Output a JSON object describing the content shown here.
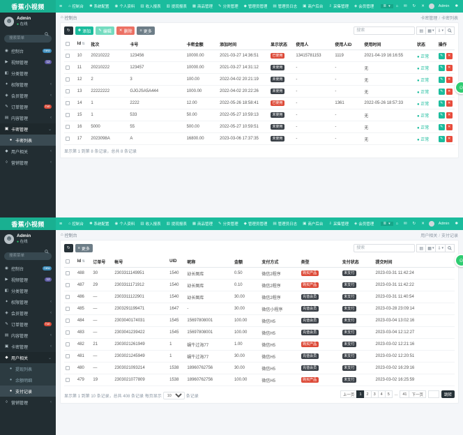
{
  "brand": {
    "logo": "香蕉小视频"
  },
  "colors": {
    "red": "#dd4b39",
    "dark": "#3b4148",
    "blue": "#3c8dbc",
    "purple": "#605ca8",
    "green": "#1bbc9d"
  },
  "topnav": {
    "burger": "≡",
    "dropdown_glyph": "≣",
    "user": "Admin",
    "settings_glyph": "✱",
    "items": [
      {
        "key": "dashboard",
        "label": "控制台",
        "glyph": "⌂"
      },
      {
        "key": "system-config",
        "label": "系统配置",
        "glyph": "✱"
      },
      {
        "key": "profile",
        "label": "个人资料",
        "glyph": "◉"
      },
      {
        "key": "income-report",
        "label": "收入报表",
        "glyph": "▥"
      },
      {
        "key": "withdraw-report",
        "label": "提现报表",
        "glyph": "▥"
      },
      {
        "key": "goods",
        "label": "商品管理",
        "glyph": "▦"
      },
      {
        "key": "category",
        "label": "分类管理",
        "glyph": "✎"
      },
      {
        "key": "admin-manage",
        "label": "管理员管理",
        "glyph": "◆"
      },
      {
        "key": "admin-log",
        "label": "管理员日志",
        "glyph": "▤"
      },
      {
        "key": "merchant",
        "label": "商户后台",
        "glyph": "▣"
      },
      {
        "key": "collect",
        "label": "采集管理",
        "glyph": "⇩"
      },
      {
        "key": "member",
        "label": "会员管理",
        "glyph": "◈"
      }
    ],
    "right_icons": [
      {
        "key": "home",
        "glyph": "⌂"
      },
      {
        "key": "message",
        "glyph": "✉"
      },
      {
        "key": "refresh",
        "glyph": "↻"
      },
      {
        "key": "close",
        "glyph": "✕"
      }
    ]
  },
  "sidebar": {
    "user": {
      "name": "Admin",
      "status": "在线"
    },
    "search_placeholder": "搜索菜单"
  },
  "panels": [
    {
      "breadcrumb": {
        "home": "控制台",
        "parent": "卡密管理",
        "current": "卡密列表"
      },
      "search_placeholder": "搜索",
      "records_text": "显示第 1 到第 8 条记录，总共 8 条记录",
      "toolbar": [
        {
          "key": "refresh",
          "icon": "↻",
          "cls": "dark"
        },
        {
          "key": "add",
          "icon": "✚",
          "label": "添加",
          "cls": "green"
        },
        {
          "key": "edit",
          "icon": "✎",
          "label": "编辑",
          "cls": "teal"
        },
        {
          "key": "delete",
          "icon": "✕",
          "label": "删除",
          "cls": "red"
        },
        {
          "key": "more",
          "icon": "≡",
          "label": "更多",
          "cls": "grey"
        }
      ],
      "sidebar": [
        {
          "key": "dashboard",
          "label": "控制台",
          "glyph": "◉",
          "icon": "dashboard-icon",
          "badge": {
            "t": "new",
            "c": "blue"
          }
        },
        {
          "key": "video",
          "label": "视频管理",
          "glyph": "▶",
          "icon": "video-icon",
          "badge": {
            "t": "12",
            "c": "purple"
          }
        },
        {
          "key": "category",
          "label": "分类管理",
          "glyph": "◧",
          "icon": "category-icon"
        },
        {
          "key": "permission",
          "label": "权限管理",
          "glyph": "✦",
          "icon": "permission-icon",
          "chevron": "‹"
        },
        {
          "key": "member",
          "label": "会员管理",
          "glyph": "◈",
          "icon": "member-icon",
          "chevron": "‹"
        },
        {
          "key": "order",
          "label": "订单管理",
          "glyph": "✎",
          "icon": "order-icon",
          "badge": {
            "t": "hot",
            "c": "red"
          }
        },
        {
          "key": "content",
          "label": "内容管理",
          "glyph": "▤",
          "icon": "content-icon",
          "chevron": "‹"
        },
        {
          "key": "card",
          "label": "卡密管理",
          "glyph": "▣",
          "icon": "card-icon",
          "chevron": "⌄",
          "open": true
        },
        {
          "key": "card-list",
          "label": "卡密列表",
          "glyph": "●",
          "icon": "dot-icon",
          "sub": true,
          "active": true
        },
        {
          "key": "user",
          "label": "用户相关",
          "glyph": "◆",
          "icon": "user-icon",
          "chevron": "‹"
        },
        {
          "key": "marketing",
          "label": "营销管理",
          "glyph": "◊",
          "icon": "marketing-icon",
          "chevron": "‹"
        }
      ],
      "table": {
        "columns": [
          {
            "key": "check",
            "type": "check",
            "label": "",
            "w": "3%"
          },
          {
            "key": "id",
            "label": "Id",
            "sort": true,
            "w": "3.5%"
          },
          {
            "key": "batch",
            "label": "批次",
            "w": "10%"
          },
          {
            "key": "card-no",
            "label": "卡号",
            "w": "14.5%"
          },
          {
            "key": "amount",
            "label": "卡密金额",
            "w": "8.5%"
          },
          {
            "key": "add-time",
            "label": "添加时间",
            "w": "13%"
          },
          {
            "key": "show-status",
            "type": "badge",
            "label": "显示状态",
            "w": "6.5%"
          },
          {
            "key": "use-user",
            "label": "使用人",
            "w": "10%"
          },
          {
            "key": "use-user-id",
            "label": "使用人ID",
            "w": "7.5%"
          },
          {
            "key": "use-time",
            "label": "使用时间",
            "w": "13.5%"
          },
          {
            "key": "status",
            "type": "status",
            "label": "状态",
            "w": "5.5%"
          },
          {
            "key": "ops",
            "type": "ops",
            "label": "操作",
            "w": "4.5%"
          }
        ],
        "rows": [
          [
            null,
            "10",
            "20210222",
            "123456",
            "10000.00",
            "2021-03-27 14:36:51",
            {
              "t": "已使用",
              "c": "red"
            },
            "13415781153",
            "1119",
            "2021-04-19 16:16:55",
            "正常",
            null
          ],
          [
            null,
            "11",
            "20210222",
            "123457",
            "10000.00",
            "2021-03-27 14:31:12",
            {
              "t": "未使用",
              "c": "dark"
            },
            "-",
            "-",
            "无",
            "正常",
            null
          ],
          [
            null,
            "12",
            "2",
            "3",
            "100.00",
            "2022-04-02 20:21:19",
            {
              "t": "未使用",
              "c": "dark"
            },
            "-",
            "-",
            "无",
            "正常",
            null
          ],
          [
            null,
            "13",
            "22222222",
            "GJGJSA5A444",
            "1000.00",
            "2022-04-02 20:22:26",
            {
              "t": "未使用",
              "c": "dark"
            },
            "-",
            "-",
            "无",
            "正常",
            null
          ],
          [
            null,
            "14",
            "1",
            "2222",
            "12.00",
            "2022-05-26 18:58:41",
            {
              "t": "已使用",
              "c": "red"
            },
            "-",
            "1361",
            "2022-05-26 18:57:33",
            "正常",
            null
          ],
          [
            null,
            "15",
            "1",
            "533",
            "50.00",
            "2022-05-27 10:59:13",
            {
              "t": "未使用",
              "c": "dark"
            },
            "-",
            "-",
            "无",
            "正常",
            null
          ],
          [
            null,
            "16",
            "5000",
            "55",
            "500.00",
            "2022-05-27 10:59:51",
            {
              "t": "未使用",
              "c": "dark"
            },
            "-",
            "-",
            "无",
            "正常",
            null
          ],
          [
            null,
            "17",
            "2023098A",
            "A",
            "16800.00",
            "2023-03-06 17:37:35",
            {
              "t": "未使用",
              "c": "dark"
            },
            "-",
            "-",
            "无",
            "正常",
            null
          ]
        ]
      }
    },
    {
      "breadcrumb": {
        "home": "控制台",
        "parent": "用户相关",
        "current": "支付记录"
      },
      "search_placeholder": "搜索",
      "records_prefix": "显示第 1 到第 10 条记录，总共 408 条记录  每页显示",
      "per_page": "10",
      "records_suffix": "条记录",
      "toolbar": [
        {
          "key": "refresh",
          "icon": "↻",
          "cls": "dark"
        },
        {
          "key": "more",
          "icon": "≡",
          "label": "更多",
          "cls": "grey"
        }
      ],
      "sidebar": [
        {
          "key": "dashboard",
          "label": "控制台",
          "glyph": "◉",
          "icon": "dashboard-icon",
          "badge": {
            "t": "new",
            "c": "blue"
          }
        },
        {
          "key": "video",
          "label": "视频管理",
          "glyph": "▶",
          "icon": "video-icon",
          "badge": {
            "t": "12",
            "c": "purple"
          }
        },
        {
          "key": "category",
          "label": "分类管理",
          "glyph": "◧",
          "icon": "category-icon"
        },
        {
          "key": "permission",
          "label": "权限管理",
          "glyph": "✦",
          "icon": "permission-icon",
          "chevron": "‹"
        },
        {
          "key": "member",
          "label": "会员管理",
          "glyph": "◈",
          "icon": "member-icon",
          "chevron": "‹"
        },
        {
          "key": "order",
          "label": "订单管理",
          "glyph": "✎",
          "icon": "order-icon",
          "badge": {
            "t": "hot",
            "c": "red"
          }
        },
        {
          "key": "content",
          "label": "内容管理",
          "glyph": "▤",
          "icon": "content-icon",
          "chevron": "‹"
        },
        {
          "key": "card",
          "label": "卡密管理",
          "glyph": "▣",
          "icon": "card-icon",
          "chevron": "‹"
        },
        {
          "key": "user",
          "label": "用户相关",
          "glyph": "◆",
          "icon": "user-icon",
          "chevron": "⌄",
          "open": true
        },
        {
          "key": "withdraw-list",
          "label": "提现列表",
          "glyph": "●",
          "icon": "dot-icon",
          "sub": true
        },
        {
          "key": "balance-detail",
          "label": "余额明细",
          "glyph": "●",
          "icon": "dot-icon",
          "sub": true
        },
        {
          "key": "pay-records",
          "label": "支付记录",
          "glyph": "●",
          "icon": "dot-icon",
          "sub": true,
          "active": true
        },
        {
          "key": "marketing",
          "label": "营销管理",
          "glyph": "◊",
          "icon": "marketing-icon",
          "chevron": "‹"
        }
      ],
      "table": {
        "columns": [
          {
            "key": "check",
            "type": "check",
            "label": "",
            "w": "3%"
          },
          {
            "key": "id",
            "label": "Id",
            "sort": true,
            "w": "4%"
          },
          {
            "key": "order-no",
            "label": "订单号",
            "w": "5.5%"
          },
          {
            "key": "account",
            "label": "帐号",
            "w": "14%"
          },
          {
            "key": "uid",
            "label": "UID",
            "w": "4.5%"
          },
          {
            "key": "nickname",
            "label": "昵称",
            "w": "12%"
          },
          {
            "key": "amount",
            "label": "金额",
            "w": "7%"
          },
          {
            "key": "pay-method",
            "label": "支付方式",
            "w": "10%"
          },
          {
            "key": "type",
            "type": "badge",
            "label": "类型",
            "w": "10.5%"
          },
          {
            "key": "pay-status",
            "type": "badge",
            "label": "支付状态",
            "w": "8.5%"
          },
          {
            "key": "submit-time",
            "label": "提交时间",
            "w": "20.5%"
          }
        ],
        "rows": [
          [
            null,
            "488",
            "30",
            "2303311149951",
            "1540",
            "幼长图库",
            "0.50",
            "微信2程序",
            {
              "t": "购买产品",
              "c": "red"
            },
            {
              "t": "未支付",
              "c": "dark"
            },
            "2023-03-31 11:42:24"
          ],
          [
            null,
            "487",
            "29",
            "2303311171912",
            "1540",
            "幼长图库",
            "0.10",
            "微信2程序",
            {
              "t": "购买产品",
              "c": "red"
            },
            {
              "t": "未支付",
              "c": "dark"
            },
            "2023-03-31 11:42:22"
          ],
          [
            null,
            "486",
            "—",
            "2303311122901",
            "1540",
            "幼长图库",
            "30.00",
            "微信2程序",
            {
              "t": "充值会员",
              "c": "dark"
            },
            {
              "t": "未支付",
              "c": "dark"
            },
            "2023-03-31 11:40:54"
          ],
          [
            null,
            "485",
            "—",
            "2303291199471",
            "1647",
            "-",
            "30.00",
            "微信小程序",
            {
              "t": "充值会员",
              "c": "dark"
            },
            {
              "t": "未支付",
              "c": "dark"
            },
            "2023-03-28 23:09:14"
          ],
          [
            null,
            "484",
            "—",
            "2303040174031",
            "1545",
            "15697808001",
            "100.00",
            "微信H5",
            {
              "t": "充值会员",
              "c": "dark"
            },
            {
              "t": "未支付",
              "c": "dark"
            },
            "2023-03-04 13:02:16"
          ],
          [
            null,
            "483",
            "—",
            "2303041239422",
            "1545",
            "15697808001",
            "100.00",
            "微信H5",
            {
              "t": "充值会员",
              "c": "dark"
            },
            {
              "t": "未支付",
              "c": "dark"
            },
            "2023-03-04 12:12:27"
          ],
          [
            null,
            "482",
            "21",
            "2303021261949",
            "1",
            "蜗牛过海77",
            "1.00",
            "微信H5",
            {
              "t": "购买产品",
              "c": "red"
            },
            {
              "t": "未支付",
              "c": "dark"
            },
            "2023-03-02 12:21:16"
          ],
          [
            null,
            "481",
            "—",
            "2303021245949",
            "1",
            "蜗牛过海77",
            "30.00",
            "微信H5",
            {
              "t": "充值会员",
              "c": "dark"
            },
            {
              "t": "未支付",
              "c": "dark"
            },
            "2023-03-02 12:20:51"
          ],
          [
            null,
            "480",
            "—",
            "2303021093214",
            "1538",
            "18960762756",
            "30.00",
            "微信H5",
            {
              "t": "充值会员",
              "c": "dark"
            },
            {
              "t": "未支付",
              "c": "dark"
            },
            "2023-03-02 16:29:16"
          ],
          [
            null,
            "479",
            "19",
            "2303021077809",
            "1538",
            "18960762756",
            "100.00",
            "微信H5",
            {
              "t": "购买产品",
              "c": "red"
            },
            {
              "t": "未支付",
              "c": "dark"
            },
            "2023-03-02 16:25:59"
          ]
        ]
      },
      "pagination": {
        "prev": "上一页",
        "pages": [
          "1",
          "2",
          "3",
          "4",
          "5",
          "...",
          "41"
        ],
        "active": "1",
        "next": "下一页",
        "jump": "跳转"
      }
    }
  ]
}
